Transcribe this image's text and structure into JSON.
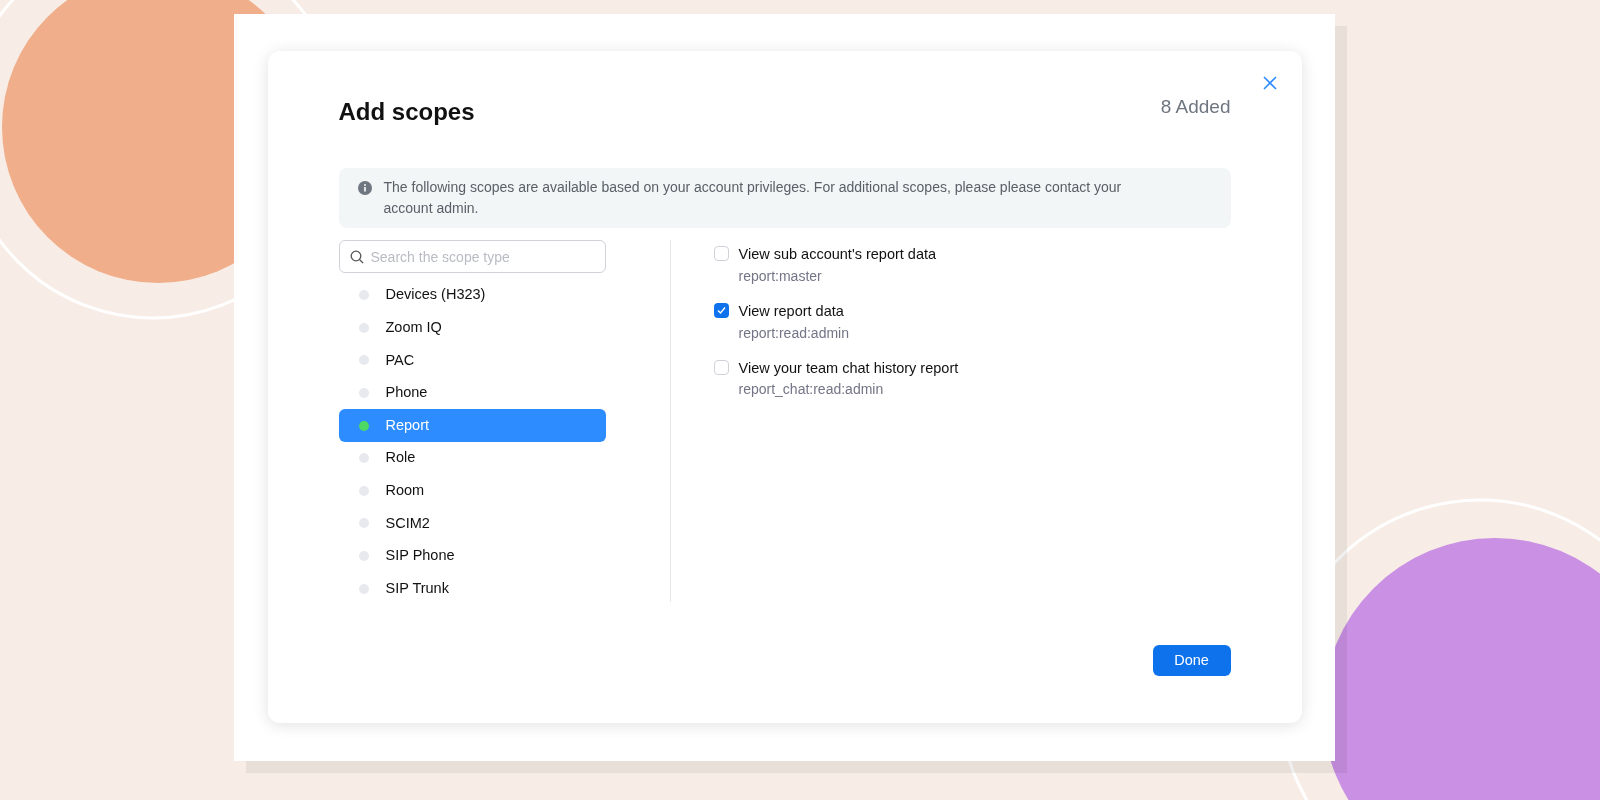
{
  "dialog": {
    "title": "Add scopes",
    "added_count": "8 Added",
    "info": "The following scopes are available based on your account privileges. For additional scopes, please please contact your account admin.",
    "search": {
      "placeholder": "Search the scope type"
    },
    "categories": [
      {
        "label": "Devices (H323)",
        "selected": false
      },
      {
        "label": "Zoom IQ",
        "selected": false
      },
      {
        "label": "PAC",
        "selected": false
      },
      {
        "label": "Phone",
        "selected": false
      },
      {
        "label": "Report",
        "selected": true
      },
      {
        "label": "Role",
        "selected": false
      },
      {
        "label": "Room",
        "selected": false
      },
      {
        "label": "SCIM2",
        "selected": false
      },
      {
        "label": "SIP Phone",
        "selected": false
      },
      {
        "label": "SIP Trunk",
        "selected": false
      }
    ],
    "scopes": [
      {
        "title": "View sub account's report data",
        "code": "report:master",
        "checked": false
      },
      {
        "title": "View report data",
        "code": "report:read:admin",
        "checked": true
      },
      {
        "title": "View your team chat history report",
        "code": "report_chat:read:admin",
        "checked": false
      }
    ],
    "done_button": "Done"
  }
}
